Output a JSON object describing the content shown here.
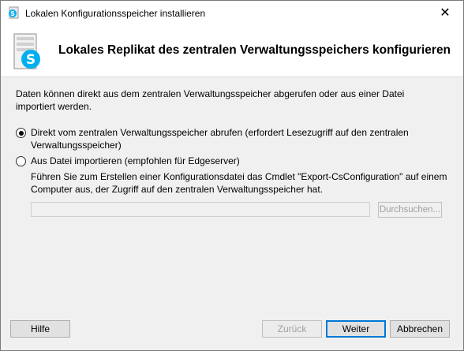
{
  "window": {
    "title": "Lokalen Konfigurationsspeicher installieren",
    "close_glyph": "✕"
  },
  "header": {
    "title": "Lokales Replikat des zentralen Verwaltungsspeichers konfigurieren",
    "icon": "skype-server-icon"
  },
  "content": {
    "intro": "Daten können direkt aus dem zentralen Verwaltungsspeicher abgerufen oder aus einer Datei importiert werden.",
    "options": [
      {
        "label": "Direkt vom zentralen Verwaltungsspeicher abrufen (erfordert Lesezugriff auf den zentralen Verwaltungsspeicher)",
        "selected": true
      },
      {
        "label": "Aus Datei importieren (empfohlen für Edgeserver)",
        "selected": false
      }
    ],
    "file_description": "Führen Sie zum Erstellen einer Konfigurationsdatei das Cmdlet \"Export-CsConfiguration\" auf einem Computer aus, der Zugriff auf den zentralen Verwaltungsspeicher hat.",
    "file_path_value": "",
    "browse_label": "Durchsuchen..."
  },
  "footer": {
    "help_label": "Hilfe",
    "back_label": "Zurück",
    "next_label": "Weiter",
    "cancel_label": "Abbrechen"
  },
  "colors": {
    "skype_blue": "#00aff0",
    "focus_blue": "#0078d7"
  }
}
